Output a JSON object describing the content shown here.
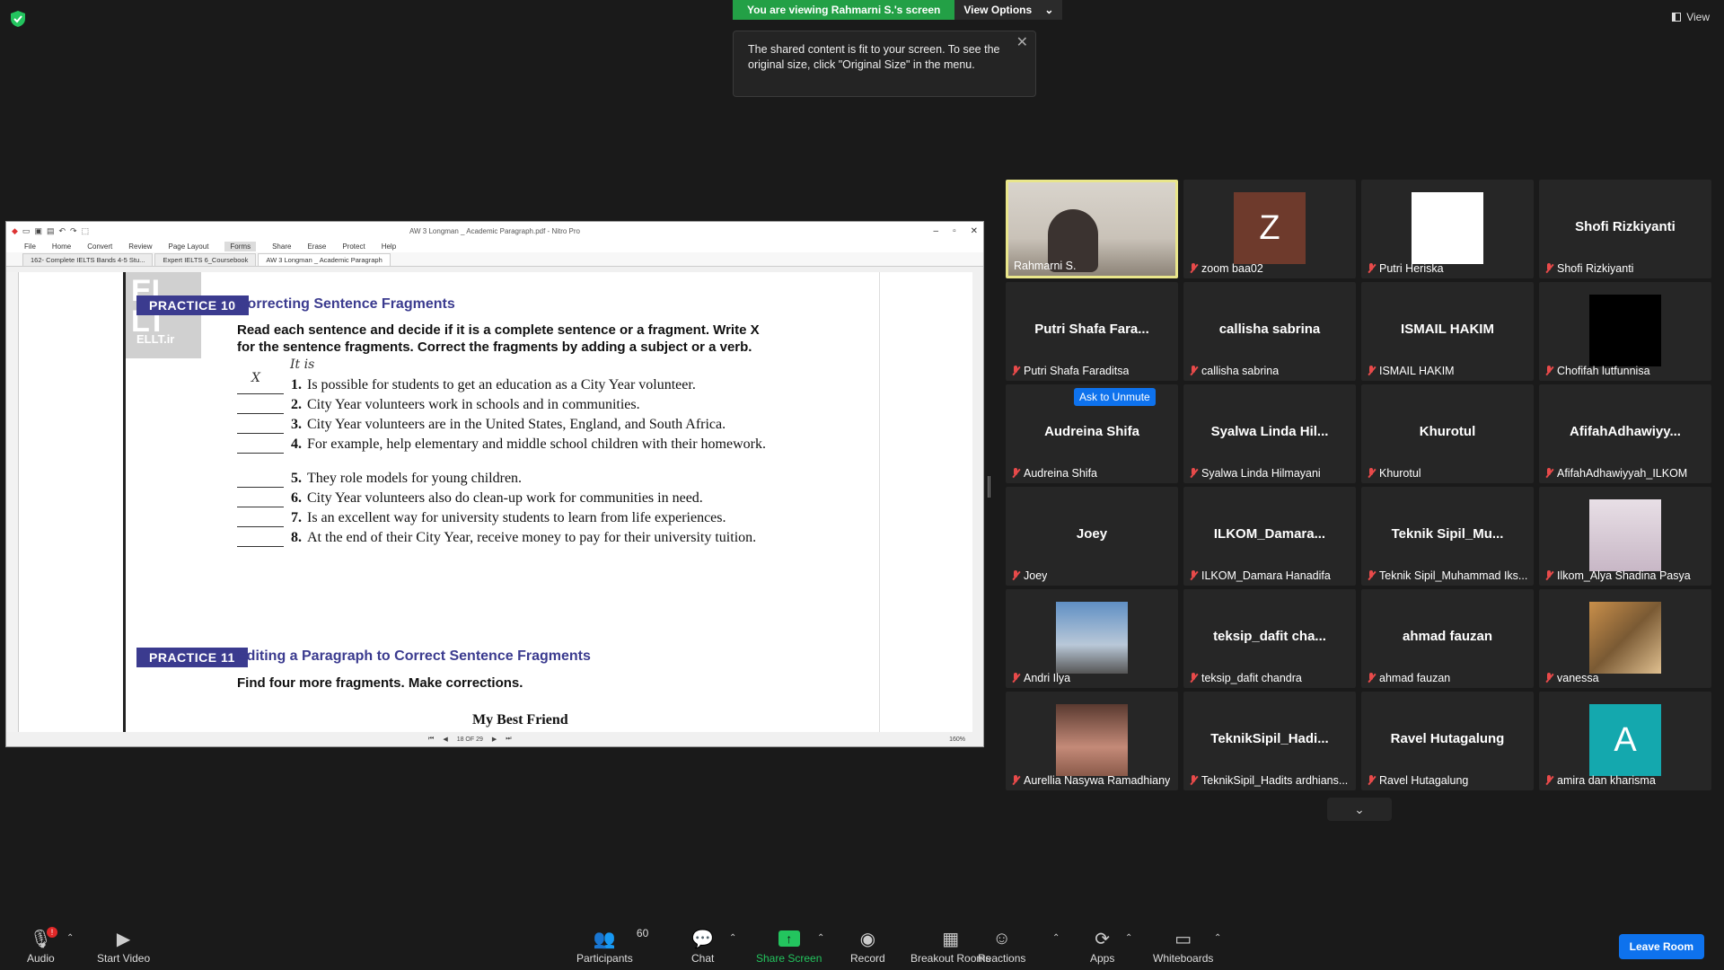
{
  "top": {
    "viewing_label": "You are viewing Rahmarni S.'s screen",
    "view_options": "View Options",
    "view_right": "View"
  },
  "tooltip": {
    "text": "The shared content is fit to your screen. To see the original size, click \"Original Size\" in the menu."
  },
  "pdf": {
    "window_title": "AW 3 Longman _ Academic Paragraph.pdf - Nitro Pro",
    "menu": [
      "File",
      "Home",
      "Convert",
      "Review",
      "Page Layout",
      "Forms",
      "Share",
      "Erase",
      "Protect",
      "Help"
    ],
    "tabs": [
      "162- Complete IELTS Bands 4-5 Stu...",
      "Expert IELTS 6_Coursebook",
      "AW 3 Longman _ Academic Paragraph"
    ],
    "page_indicator": "18 OF 29",
    "zoom": "160%",
    "watermark": "ELLT.ir",
    "practice10_badge": "PRACTICE 10",
    "practice10_title": "Correcting Sentence Fragments",
    "practice10_instructions": "Read each sentence and decide if it is a complete sentence or a fragment. Write X for the sentence fragments. Correct the fragments by adding a subject or a verb.",
    "handwritten_answer": "X",
    "handwritten_insert": "It is",
    "items": [
      {
        "num": "1.",
        "text": "Is possible for students to get an education as a City Year volunteer."
      },
      {
        "num": "2.",
        "text": "City Year volunteers work in schools and in communities."
      },
      {
        "num": "3.",
        "text": "City Year volunteers are in the United States, England, and South Africa."
      },
      {
        "num": "4.",
        "text": "For example, help elementary and middle school children with their homework."
      },
      {
        "num": "5.",
        "text": "They role models for young children."
      },
      {
        "num": "6.",
        "text": "City Year volunteers also do clean-up work for communities in need."
      },
      {
        "num": "7.",
        "text": "Is an excellent way for university students to learn from life experiences."
      },
      {
        "num": "8.",
        "text": "At the end of their City Year, receive money to pay for their university tuition."
      }
    ],
    "practice11_badge": "PRACTICE 11",
    "practice11_title": "Editing a Paragraph to Correct Sentence Fragments",
    "practice11_instructions": "Find four more fragments. Make corrections.",
    "subtitle": "My Best Friend"
  },
  "gallery": {
    "ask_to_unmute": "Ask to Unmute",
    "tiles": [
      {
        "big": "",
        "label": "Rahmarni S.",
        "muted": false,
        "kind": "video"
      },
      {
        "big": "",
        "label": "zoom baa02",
        "muted": true,
        "kind": "letter",
        "letter": "Z",
        "color": "#6e3a2c"
      },
      {
        "big": "",
        "label": "Putri Heriska",
        "muted": true,
        "kind": "white"
      },
      {
        "big": "Shofi Rizkiyanti",
        "label": "Shofi Rizkiyanti",
        "muted": true,
        "kind": "name"
      },
      {
        "big": "Putri Shafa Fara...",
        "label": "Putri Shafa Faraditsa",
        "muted": true,
        "kind": "name"
      },
      {
        "big": "callisha sabrina",
        "label": "callisha sabrina",
        "muted": true,
        "kind": "name"
      },
      {
        "big": "ISMAIL HAKIM",
        "label": "ISMAIL HAKIM",
        "muted": true,
        "kind": "name"
      },
      {
        "big": "",
        "label": "Chofifah lutfunnisa",
        "muted": true,
        "kind": "black"
      },
      {
        "big": "Audreina Shifa",
        "label": "Audreina Shifa",
        "muted": true,
        "kind": "name"
      },
      {
        "big": "Syalwa Linda Hil...",
        "label": "Syalwa Linda Hilmayani",
        "muted": true,
        "kind": "name"
      },
      {
        "big": "Khurotul",
        "label": "Khurotul",
        "muted": true,
        "kind": "name"
      },
      {
        "big": "AfifahAdhawiyy...",
        "label": "AfifahAdhawiyyah_ILKOM",
        "muted": true,
        "kind": "name"
      },
      {
        "big": "Joey",
        "label": "Joey",
        "muted": true,
        "kind": "name"
      },
      {
        "big": "ILKOM_Damara...",
        "label": "ILKOM_Damara Hanadifa",
        "muted": true,
        "kind": "name"
      },
      {
        "big": "Teknik Sipil_Mu...",
        "label": "Teknik Sipil_Muhammad Iks...",
        "muted": true,
        "kind": "name"
      },
      {
        "big": "",
        "label": "Ilkom_Alya Shadina Pasya",
        "muted": true,
        "kind": "photo-hijab"
      },
      {
        "big": "",
        "label": "Andri Ilya",
        "muted": true,
        "kind": "photo-sky"
      },
      {
        "big": "teksip_dafit cha...",
        "label": "teksip_dafit chandra",
        "muted": true,
        "kind": "name"
      },
      {
        "big": "ahmad fauzan",
        "label": "ahmad fauzan",
        "muted": true,
        "kind": "name"
      },
      {
        "big": "",
        "label": "vanessa",
        "muted": true,
        "kind": "photo-food"
      },
      {
        "big": "",
        "label": "Aurellia Nasywa Ramadhiany",
        "muted": true,
        "kind": "photo-baby"
      },
      {
        "big": "TeknikSipil_Hadi...",
        "label": "TeknikSipil_Hadits ardhians...",
        "muted": true,
        "kind": "name"
      },
      {
        "big": "Ravel Hutagalung",
        "label": "Ravel Hutagalung",
        "muted": true,
        "kind": "name"
      },
      {
        "big": "",
        "label": "amira dan kharisma",
        "muted": true,
        "kind": "letter",
        "letter": "A",
        "color": "#14a8ae"
      }
    ]
  },
  "toolbar": {
    "audio": "Audio",
    "audio_badge": "!",
    "start_video": "Start Video",
    "participants": "Participants",
    "participants_count": "60",
    "chat": "Chat",
    "share_screen": "Share Screen",
    "record": "Record",
    "breakout_rooms": "Breakout Rooms",
    "reactions": "Reactions",
    "apps": "Apps",
    "whiteboards": "Whiteboards",
    "leave_room": "Leave Room"
  }
}
